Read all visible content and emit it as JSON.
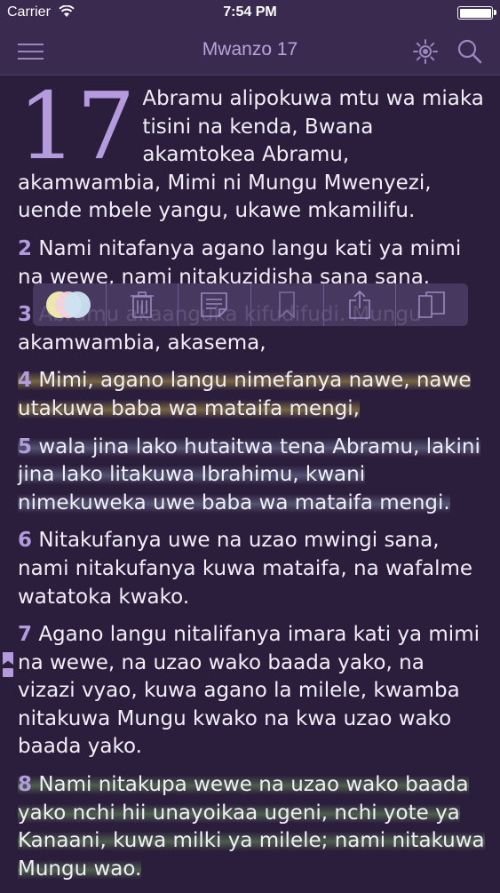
{
  "status": {
    "carrier": "Carrier",
    "time": "7:54 PM",
    "battery_level": 1.0
  },
  "nav": {
    "title": "Mwanzo 17",
    "icons": [
      "menu-icon",
      "brightness-icon",
      "search-icon"
    ]
  },
  "chapter": {
    "number": "17",
    "verses": [
      {
        "num": "",
        "text": "Abramu alipokuwa mtu wa miaka tisini na kenda, Bwana akamtokea Abramu, akamwambia, Mimi ni Mungu Mwenyezi, uende mbele yangu, ukawe mkamilifu.",
        "highlight": ""
      },
      {
        "num": "2",
        "text": "Nami nitafanya agano langu kati ya mimi na wewe, nami nitakuzidisha sana sana.",
        "highlight": ""
      },
      {
        "num": "3",
        "text": "Abramu akaanguka kifudifudi. Mungu akamwambia, akasema,",
        "highlight": ""
      },
      {
        "num": "4",
        "text": "Mimi, agano langu nimefanya nawe, nawe utakuwa baba wa mataifa mengi,",
        "highlight": "yellow"
      },
      {
        "num": "5",
        "text": "wala jina lako hutaitwa tena Abramu, lakini jina lako litakuwa Ibrahimu, kwani nimekuweka uwe baba wa mataifa mengi.",
        "highlight": "blue"
      },
      {
        "num": "6",
        "text": "Nitakufanya uwe na uzao mwingi sana, nami nitakufanya kuwa mataifa, na wafalme watatoka kwako.",
        "highlight": ""
      },
      {
        "num": "7",
        "text": "Agano langu nitalifanya imara kati ya mimi na wewe, na uzao wako baada yako, na vizazi vyao, kuwa agano la milele, kwamba nitakuwa Mungu kwako na kwa uzao wako baada yako.",
        "highlight": ""
      },
      {
        "num": "8",
        "text": "Nami nitakupa wewe na uzao wako baada yako nchi hii unayoikaa ugeni, nchi yote ya Kanaani, kuwa milki ya milele; nami nitakuwa Mungu wao.",
        "highlight": "green"
      }
    ]
  },
  "toolbar": {
    "highlight_colors": [
      "#f5f0b0",
      "#f3d2dc",
      "#cde3f3"
    ],
    "icons": [
      "highlight-colors-icon",
      "trash-icon",
      "note-icon",
      "bookmark-icon",
      "share-icon",
      "copy-icon"
    ]
  },
  "colors": {
    "background": "#2b1d3c",
    "bar": "#3a2a4f",
    "accent": "#b49bdd"
  }
}
